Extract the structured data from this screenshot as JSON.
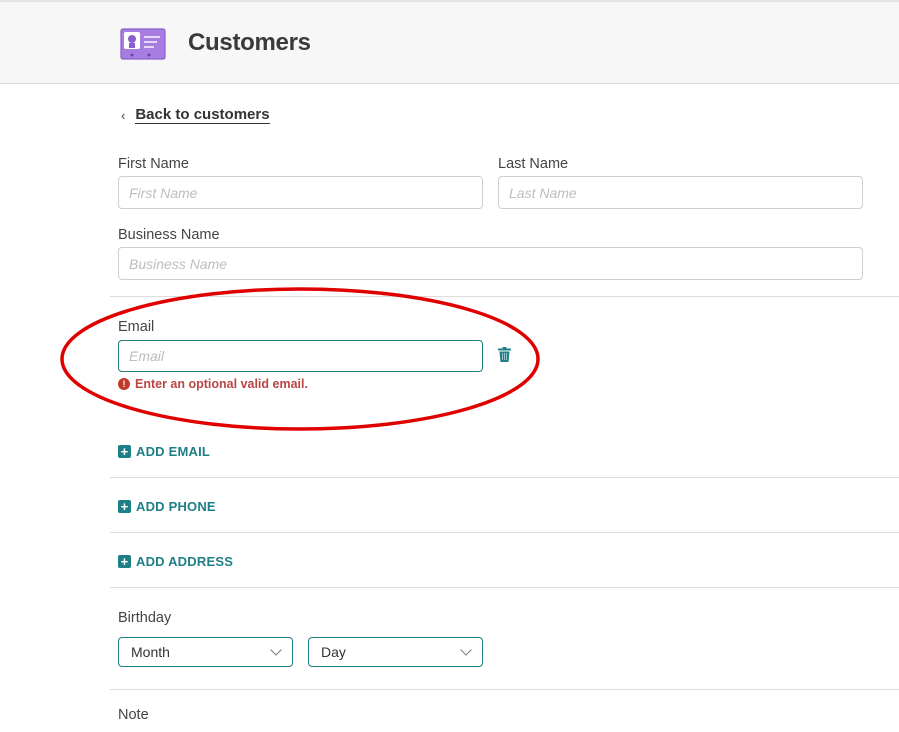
{
  "header": {
    "title": "Customers",
    "icon": "customer-card-icon"
  },
  "back": {
    "label": "Back to customers"
  },
  "form": {
    "first_name": {
      "label": "First Name",
      "placeholder": "First Name",
      "value": ""
    },
    "last_name": {
      "label": "Last Name",
      "placeholder": "Last Name",
      "value": ""
    },
    "business_name": {
      "label": "Business Name",
      "placeholder": "Business Name",
      "value": ""
    },
    "email": {
      "label": "Email",
      "placeholder": "Email",
      "value": "",
      "error": "Enter an optional valid email."
    },
    "add_email": "ADD EMAIL",
    "add_phone": "ADD PHONE",
    "add_address": "ADD ADDRESS",
    "birthday": {
      "label": "Birthday",
      "month": "Month",
      "day": "Day"
    },
    "note": {
      "label": "Note"
    }
  },
  "colors": {
    "accent": "#1e7f86",
    "error": "#b94545",
    "highlight": "#e00000",
    "brand_icon": "#9b6bd6"
  }
}
